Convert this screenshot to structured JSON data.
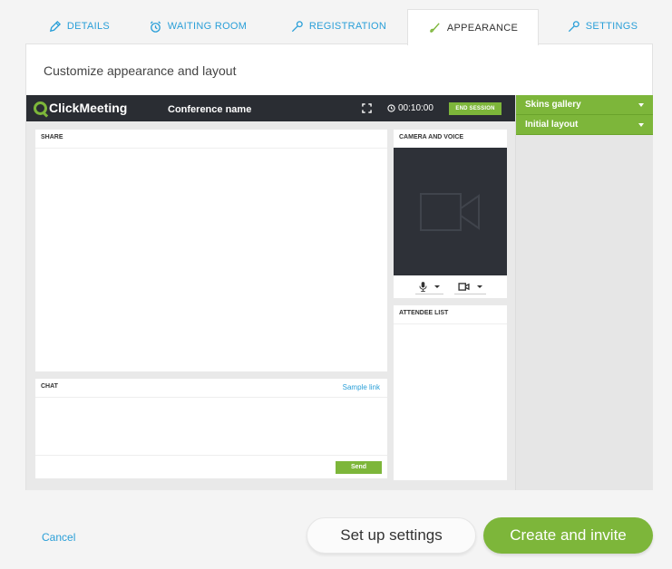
{
  "tabs": [
    {
      "label": "DETAILS",
      "icon": "pencil-icon"
    },
    {
      "label": "WAITING ROOM",
      "icon": "alarm-clock-icon"
    },
    {
      "label": "REGISTRATION",
      "icon": "wrench-icon"
    },
    {
      "label": "APPEARANCE",
      "icon": "brush-icon",
      "active": true
    },
    {
      "label": "SETTINGS",
      "icon": "wrench-icon"
    }
  ],
  "panel": {
    "title": "Customize appearance and layout"
  },
  "preview": {
    "logo": "ClickMeeting",
    "conference_name": "Conference name",
    "timer": "00:10:00",
    "end_session": "END SESSION",
    "share_label": "SHARE",
    "chat_label": "CHAT",
    "sample_link": "Sample link",
    "send": "Send",
    "camera_label": "CAMERA AND VOICE",
    "attendee_label": "ATTENDEE LIST"
  },
  "sidebar": {
    "items": [
      {
        "label": "Skins gallery"
      },
      {
        "label": "Initial layout"
      }
    ]
  },
  "footer": {
    "cancel": "Cancel",
    "setup": "Set up settings",
    "create": "Create and invite"
  },
  "colors": {
    "accent_green": "#7db63a",
    "link_blue": "#2a9fd8",
    "dark_bar": "#2a2d33"
  }
}
